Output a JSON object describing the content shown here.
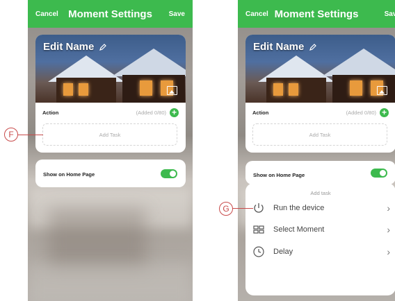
{
  "screens": [
    {
      "topbar": {
        "cancel": "Cancel",
        "title": "Moment Settings",
        "save": "Save"
      },
      "card": {
        "edit_name": "Edit Name",
        "action_label": "Action",
        "added": "(Added 0/80)",
        "add_task": "Add Task"
      },
      "show": {
        "label": "Show on Home Page",
        "toggle_on": true
      }
    },
    {
      "topbar": {
        "cancel": "Cancel",
        "title": "Moment Settings",
        "save": "Save"
      },
      "card": {
        "edit_name": "Edit Name",
        "action_label": "Action",
        "added": "(Added 0/80)",
        "add_task": "Add Task"
      },
      "show": {
        "label": "Show on Home Page",
        "toggle_on": true
      },
      "sheet": {
        "title": "Add task",
        "items": [
          {
            "label": "Run the device",
            "icon": "power-icon"
          },
          {
            "label": "Select Moment",
            "icon": "grid-icon"
          },
          {
            "label": "Delay",
            "icon": "clock-icon"
          }
        ]
      }
    }
  ],
  "callouts": {
    "f": "F",
    "g": "G"
  },
  "colors": {
    "accent": "#3dba4e",
    "callout": "#c84a4a"
  }
}
